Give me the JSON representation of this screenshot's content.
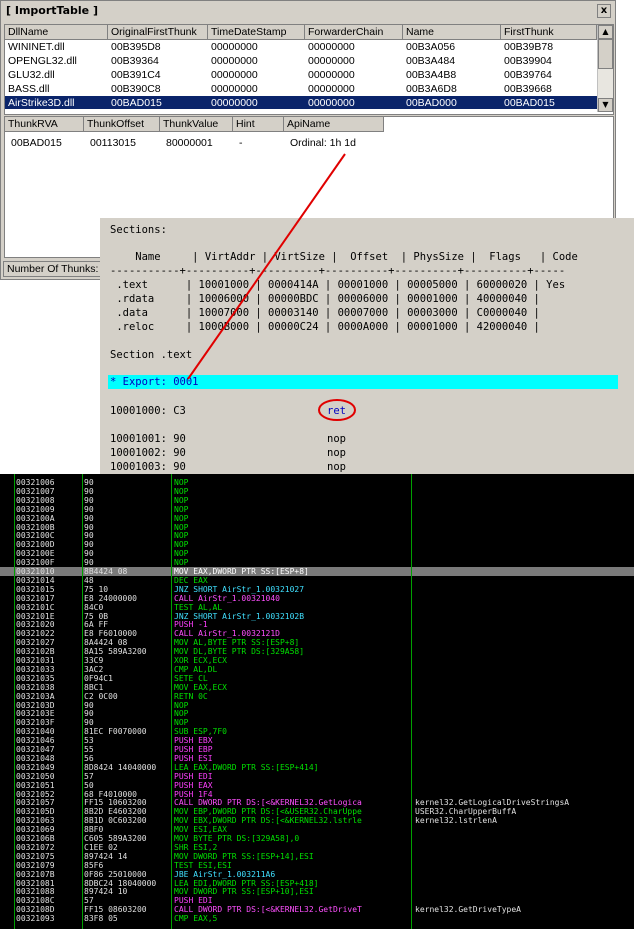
{
  "window": {
    "title": "[ ImportTable ]",
    "close_glyph": "x"
  },
  "top_grid": {
    "columns": [
      "DllName",
      "OriginalFirstThunk",
      "TimeDateStamp",
      "ForwarderChain",
      "Name",
      "FirstThunk"
    ],
    "rows": [
      [
        "WININET.dll",
        "00B395D8",
        "00000000",
        "00000000",
        "00B3A056",
        "00B39B78"
      ],
      [
        "OPENGL32.dll",
        "00B39364",
        "00000000",
        "00000000",
        "00B3A484",
        "00B39904"
      ],
      [
        "GLU32.dll",
        "00B391C4",
        "00000000",
        "00000000",
        "00B3A4B8",
        "00B39764"
      ],
      [
        "BASS.dll",
        "00B390C8",
        "00000000",
        "00000000",
        "00B3A6D8",
        "00B39668"
      ],
      [
        "AirStrike3D.dll",
        "00BAD015",
        "00000000",
        "00000000",
        "00BAD000",
        "00BAD015"
      ]
    ]
  },
  "thunk_grid": {
    "columns": [
      "ThunkRVA",
      "ThunkOffset",
      "ThunkValue",
      "Hint",
      "ApiName"
    ],
    "rows": [
      [
        "00BAD015",
        "00113015",
        "80000001",
        "-",
        "Ordinal: 1h 1d"
      ]
    ]
  },
  "status": {
    "label": "Number Of Thunks:"
  },
  "sections_panel": {
    "title": "Sections:",
    "header": "    Name     | VirtAddr | VirtSize |  Offset  | PhysSize |  Flags   | Code",
    "separator": "-----------+----------+----------+----------+----------+----------+-----",
    "rows": [
      " .text      | 10001000 | 0000414A | 00001000 | 00005000 | 60000020 | Yes",
      " .rdata     | 10006000 | 00000BDC | 00006000 | 00001000 | 40000040 |",
      " .data      | 10007000 | 00003140 | 00007000 | 00003000 | C0000040 |",
      " .reloc     | 1000B000 | 00000C24 | 0000A000 | 00001000 | 42000040 |"
    ],
    "section_label": "Section .text",
    "export_line": "* Export: 0001",
    "code_lines": [
      {
        "addr": "10001000: C3",
        "op": "ret"
      },
      {
        "addr": "10001001: 90",
        "op": "nop"
      },
      {
        "addr": "10001002: 90",
        "op": "nop"
      },
      {
        "addr": "10001003: 90",
        "op": "nop"
      }
    ]
  },
  "disasm": [
    {
      "a": "00321006",
      "h": "90",
      "i": "NOP",
      "c": "",
      "k": "nop"
    },
    {
      "a": "00321007",
      "h": "90",
      "i": "NOP",
      "c": "",
      "k": "nop"
    },
    {
      "a": "00321008",
      "h": "90",
      "i": "NOP",
      "c": "",
      "k": "nop"
    },
    {
      "a": "00321009",
      "h": "90",
      "i": "NOP",
      "c": "",
      "k": "nop"
    },
    {
      "a": "0032100A",
      "h": "90",
      "i": "NOP",
      "c": "",
      "k": "nop"
    },
    {
      "a": "0032100B",
      "h": "90",
      "i": "NOP",
      "c": "",
      "k": "nop"
    },
    {
      "a": "0032100C",
      "h": "90",
      "i": "NOP",
      "c": "",
      "k": "nop"
    },
    {
      "a": "0032100D",
      "h": "90",
      "i": "NOP",
      "c": "",
      "k": "nop"
    },
    {
      "a": "0032100E",
      "h": "90",
      "i": "NOP",
      "c": "",
      "k": "nop"
    },
    {
      "a": "0032100F",
      "h": "90",
      "i": "NOP",
      "c": "",
      "k": "nop"
    },
    {
      "a": "00321010",
      "h": "8B4424 08",
      "i": "MOV EAX,DWORD PTR SS:[ESP+8]",
      "c": "",
      "k": "hl"
    },
    {
      "a": "00321014",
      "h": "48",
      "i": "DEC EAX",
      "c": "",
      "k": "def"
    },
    {
      "a": "00321015",
      "h": "75 10",
      "i": "JNZ SHORT AirStr_1.00321027",
      "c": "",
      "k": "jmp"
    },
    {
      "a": "00321017",
      "h": "E8 24000000",
      "i": "CALL AirStr_1.00321040",
      "c": "",
      "k": "call"
    },
    {
      "a": "0032101C",
      "h": "84C0",
      "i": "TEST AL,AL",
      "c": "",
      "k": "def"
    },
    {
      "a": "0032101E",
      "h": "75 0B",
      "i": "JNZ SHORT AirStr_1.0032102B",
      "c": "",
      "k": "jmp"
    },
    {
      "a": "00321020",
      "h": "6A FF",
      "i": "PUSH -1",
      "c": "",
      "k": "push"
    },
    {
      "a": "00321022",
      "h": "E8 F6010000",
      "i": "CALL AirStr_1.0032121D",
      "c": "",
      "k": "call"
    },
    {
      "a": "00321027",
      "h": "8A4424 08",
      "i": "MOV AL,BYTE PTR SS:[ESP+8]",
      "c": "",
      "k": "mov"
    },
    {
      "a": "0032102B",
      "h": "8A15 589A3200",
      "i": "MOV DL,BYTE PTR DS:[329A58]",
      "c": "",
      "k": "mov"
    },
    {
      "a": "00321031",
      "h": "33C9",
      "i": "XOR ECX,ECX",
      "c": "",
      "k": "def"
    },
    {
      "a": "00321033",
      "h": "3AC2",
      "i": "CMP AL,DL",
      "c": "",
      "k": "def"
    },
    {
      "a": "00321035",
      "h": "0F94C1",
      "i": "SETE CL",
      "c": "",
      "k": "def"
    },
    {
      "a": "00321038",
      "h": "8BC1",
      "i": "MOV EAX,ECX",
      "c": "",
      "k": "def"
    },
    {
      "a": "0032103A",
      "h": "C2 0C00",
      "i": "RETN 0C",
      "c": "",
      "k": "def"
    },
    {
      "a": "0032103D",
      "h": "90",
      "i": "NOP",
      "c": "",
      "k": "nop"
    },
    {
      "a": "0032103E",
      "h": "90",
      "i": "NOP",
      "c": "",
      "k": "nop"
    },
    {
      "a": "0032103F",
      "h": "90",
      "i": "NOP",
      "c": "",
      "k": "nop"
    },
    {
      "a": "00321040",
      "h": "81EC F0070000",
      "i": "SUB ESP,7F0",
      "c": "",
      "k": "def"
    },
    {
      "a": "00321046",
      "h": "53",
      "i": "PUSH EBX",
      "c": "",
      "k": "push"
    },
    {
      "a": "00321047",
      "h": "55",
      "i": "PUSH EBP",
      "c": "",
      "k": "push"
    },
    {
      "a": "00321048",
      "h": "56",
      "i": "PUSH ESI",
      "c": "",
      "k": "push"
    },
    {
      "a": "00321049",
      "h": "8D8424 14040000",
      "i": "LEA EAX,DWORD PTR SS:[ESP+414]",
      "c": "",
      "k": "mov"
    },
    {
      "a": "00321050",
      "h": "57",
      "i": "PUSH EDI",
      "c": "",
      "k": "push"
    },
    {
      "a": "00321051",
      "h": "50",
      "i": "PUSH EAX",
      "c": "",
      "k": "push"
    },
    {
      "a": "00321052",
      "h": "68 F4010000",
      "i": "PUSH 1F4",
      "c": "",
      "k": "push"
    },
    {
      "a": "00321057",
      "h": "FF15 10603200",
      "i": "CALL DWORD PTR DS:[<&KERNEL32.GetLogica",
      "c": "kernel32.GetLogicalDriveStringsA",
      "k": "call"
    },
    {
      "a": "0032105D",
      "h": "8B2D E4603200",
      "i": "MOV EBP,DWORD PTR DS:[<&USER32.CharUppe",
      "c": "USER32.CharUpperBuffA",
      "k": "mov"
    },
    {
      "a": "00321063",
      "h": "8B1D 0C603200",
      "i": "MOV EBX,DWORD PTR DS:[<&KERNEL32.lstrle",
      "c": "kernel32.lstrlenA",
      "k": "mov"
    },
    {
      "a": "00321069",
      "h": "8BF0",
      "i": "MOV ESI,EAX",
      "c": "",
      "k": "def"
    },
    {
      "a": "0032106B",
      "h": "C605 589A3200",
      "i": "MOV BYTE PTR DS:[329A58],0",
      "c": "",
      "k": "mov"
    },
    {
      "a": "00321072",
      "h": "C1EE 02",
      "i": "SHR ESI,2",
      "c": "",
      "k": "def"
    },
    {
      "a": "00321075",
      "h": "897424 14",
      "i": "MOV DWORD PTR SS:[ESP+14],ESI",
      "c": "",
      "k": "mov"
    },
    {
      "a": "00321079",
      "h": "85F6",
      "i": "TEST ESI,ESI",
      "c": "",
      "k": "def"
    },
    {
      "a": "0032107B",
      "h": "0F86 25010000",
      "i": "JBE AirStr_1.003211A6",
      "c": "",
      "k": "jmp"
    },
    {
      "a": "00321081",
      "h": "8DBC24 18040000",
      "i": "LEA EDI,DWORD PTR SS:[ESP+418]",
      "c": "",
      "k": "mov"
    },
    {
      "a": "00321088",
      "h": "897424 10",
      "i": "MOV DWORD PTR SS:[ESP+10],ESI",
      "c": "",
      "k": "mov"
    },
    {
      "a": "0032108C",
      "h": "57",
      "i": "PUSH EDI",
      "c": "",
      "k": "push"
    },
    {
      "a": "0032108D",
      "h": "FF15 08603200",
      "i": "CALL DWORD PTR DS:[<&KERNEL32.GetDriveT",
      "c": "kernel32.GetDriveTypeA",
      "k": "call"
    },
    {
      "a": "00321093",
      "h": "83F8 05",
      "i": "CMP EAX,5",
      "c": "",
      "k": "def"
    }
  ]
}
